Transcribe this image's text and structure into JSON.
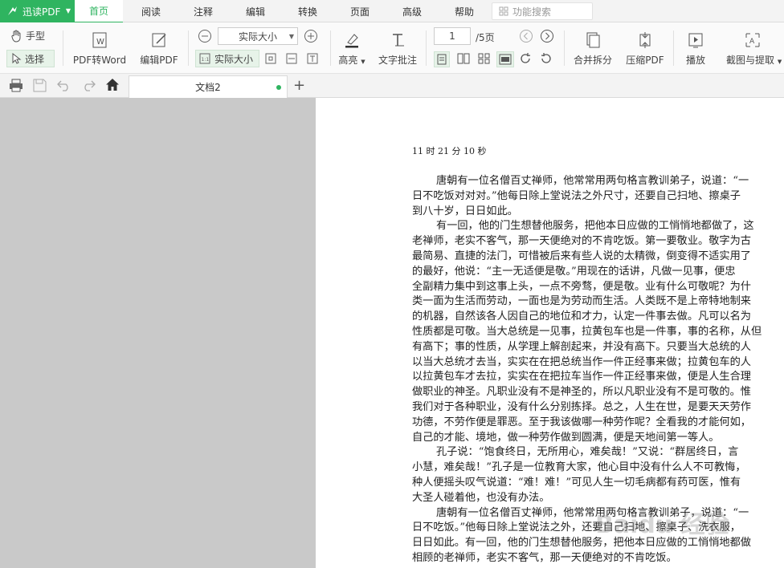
{
  "app": {
    "brand": "迅读PDF"
  },
  "menu": [
    "首页",
    "阅读",
    "注释",
    "编辑",
    "转换",
    "页面",
    "高级",
    "帮助"
  ],
  "search": {
    "placeholder": "功能搜索"
  },
  "toolbar": {
    "hand": "手型",
    "select": "选择",
    "pdf_to_word": "PDF转Word",
    "edit_pdf": "编辑PDF",
    "zoom_value": "实际大小",
    "actual_size": "实际大小",
    "highlight": "高亮",
    "text_note": "文字批注",
    "page_input": "1",
    "page_total": "/5页",
    "merge_split": "合并拆分",
    "compress": "压缩PDF",
    "play": "播放",
    "crop_extract": "截图与提取"
  },
  "tab": {
    "name": "文档2",
    "new_tab": "+"
  },
  "document": {
    "timestamp": "11 时 21 分 10 秒",
    "lines": [
      "唐朝有一位名僧百丈禅师，他常常用两句格言教训弟子，说道：“一",
      "日不吃饭对对对。”他每日除上堂说法之外尺寸，还要自己扫地、擦桌子",
      "到八十岁，日日如此。",
      "有一回，他的门生想替他服务，把他本日应做的工悄悄地都做了，这",
      "老禅师，老实不客气，那一天便绝对的不肯吃饭。第一要敬业。敬字为古",
      "最简易、直捷的法门，可惜被后来有些人说的太精微，倒变得不适实用了",
      "的最好，他说：“主一无适便是敬。”用现在的话讲，凡做一见事，便忠",
      "全副精力集中到这事上头，一点不旁骛，便是敬。业有什么可敬呢？为什",
      "类一面为生活而劳动，一面也是为劳动而生活。人类既不是上帝特地制来",
      "的机器，自然该各人因自己的地位和才力，认定一件事去做。凡可以名为",
      "性质都是可敬。当大总统是一见事，拉黄包车也是一件事，事的名称，从但",
      "有高下；事的性质，从学理上解剖起来，并没有高下。只要当大总统的人",
      "以当大总统才去当，实实在在把总统当作一件正经事来做；拉黄包车的人",
      "以拉黄包车才去拉，实实在在把拉车当作一件正经事来做，便是人生合理",
      "做职业的神圣。凡职业没有不是神圣的，所以凡职业没有不是可敬的。惟",
      "我们对于各种职业，没有什么分别拣择。总之，人生在世，是要天天劳作",
      "功德，不劳作便是罪恶。至于我该做哪一种劳作呢？全看我的才能何如，",
      "自己的才能、境地，做一种劳作做到圆满，便是天地间第一等人。",
      "孔子说：“饱食终日，无所用心，难矣哉！”又说：“群居终日，言",
      "小慧，难矣哉！”孔子是一位教育大家，他心目中没有什么人不可教悔，",
      "种人便摇头叹气说道：“难！难！”可见人生一切毛病都有药可医，惟有",
      "大圣人碰着他，也没有办法。",
      "唐朝有一位名僧百丈禅师，他常常用两句格言教训弟子，说道：“一",
      "日不吃饭。”他每日除上堂说法之外，还要自己扫地、擦桌子、洗衣服，",
      "日日如此。有一回，他的门生想替他服务，把他本日应做的工悄悄地都做",
      "相顾的老禅师，老实不客气，那一天便绝对的不肯吃饭。"
    ],
    "indented": [
      0,
      3,
      18,
      22
    ],
    "watermark": "Baidu 经验"
  },
  "colors": {
    "accent": "#2fb460",
    "pane_bg": "#c9c9c9"
  }
}
